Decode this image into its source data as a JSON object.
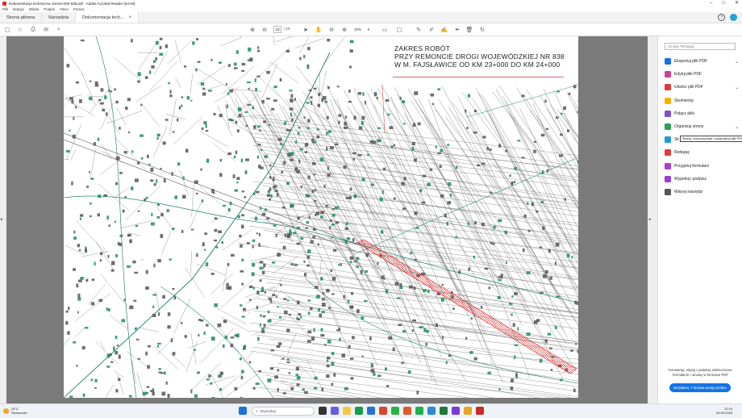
{
  "window": {
    "title": "Dokumentacja techniczna remont DW 838.pdf - Adobe Acrobat Reader (64-bit)",
    "controls": [
      "–",
      "□",
      "✕"
    ]
  },
  "menu": [
    "Plik",
    "Edycja",
    "Widok",
    "Podpis",
    "Okno",
    "Pomoc"
  ],
  "tabs": [
    {
      "label": "Strona główna"
    },
    {
      "label": "Narzędzia"
    },
    {
      "label": "Dokumentacja tech...",
      "close": "×"
    }
  ],
  "toolbar": {
    "current_page": "10",
    "page_total": "/ 10",
    "zoom": "10%"
  },
  "document": {
    "title_lines": [
      "ZAKRES ROBÓT",
      "PRZY REMONCIE DROGI WOJEWÓDZKIEJ NR 838",
      "W M. FAJSŁAWICE OD KM 23+000 DO KM 24+000"
    ]
  },
  "sidebar": {
    "search_placeholder": "Szukaj 'Redaguj'",
    "tools": [
      {
        "label": "Eksportuj plik PDF",
        "color": "#1473e6",
        "chev": true
      },
      {
        "label": "Edytuj plik PDF",
        "color": "#d43f8d",
        "chev": false
      },
      {
        "label": "Utwórz plik PDF",
        "color": "#e03a3e",
        "chev": true
      },
      {
        "label": "Skomentuj",
        "color": "#f5b400",
        "chev": false
      },
      {
        "label": "Połącz pliki",
        "color": "#7a4fd1",
        "chev": false
      },
      {
        "label": "Organizuj strony",
        "color": "#2ca05a",
        "chev": true
      },
      {
        "label": "Sk",
        "color": "#1c9bd6",
        "chev": false
      },
      {
        "label": "Redaguj",
        "color": "#e03a3e",
        "chev": false
      },
      {
        "label": "Przygotuj formularz",
        "color": "#b23ad4",
        "chev": false
      },
      {
        "label": "Wypełnij i podpisz",
        "color": "#9a3ad4",
        "chev": false
      },
      {
        "label": "Więcej narzędzi",
        "color": "#555555",
        "chev": false
      }
    ],
    "tooltip": "Skanuj, rozpoznaj tekst i zoptymalizuj pliki PDF",
    "promo_text": "Konwertuj, edytuj i podpisuj elektroniczne formularze i umowy w formacie PDF",
    "promo_button": "Bezpłatna, 7-dniowa wersja próbna"
  },
  "taskbar": {
    "temp": "24°C",
    "weather": "Słonecznie",
    "search": "Wyszukaj",
    "time": "12:19",
    "date": "09.06.2023"
  }
}
